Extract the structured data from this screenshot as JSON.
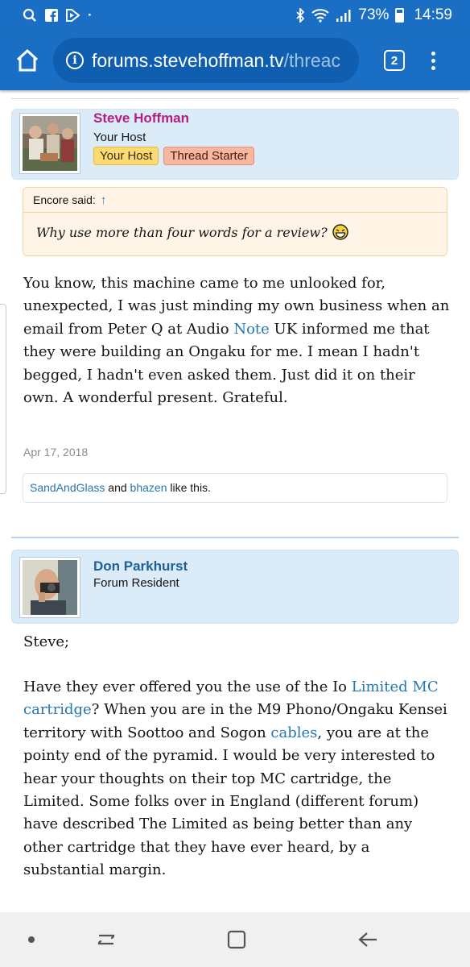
{
  "status_bar": {
    "battery": "73%",
    "time": "14:59"
  },
  "browser": {
    "url_domain": "forums.stevehoffman.tv",
    "url_path": "/threac",
    "tab_count": "2"
  },
  "post1": {
    "author": "Steve Hoffman",
    "author_title": "Your Host",
    "banners": [
      "Your Host",
      "Thread Starter"
    ],
    "quote_author": "Encore said:",
    "quote_arrow": "↑",
    "quote_text": "Why use more than four words for a review?",
    "text_before_link": "You know, this machine came to me unlooked for, unexpected, I was just minding my own business when an email from Peter Q at Audio ",
    "link_text": "Note",
    "text_after_link": " UK informed me that they were building an Ongaku for me. I mean I hadn't begged, I hadn't even asked them. Just did it on their own. A wonderful present. Grateful.",
    "date": "Apr 17, 2018",
    "liker1": "SandAndGlass",
    "likes_and": " and ",
    "liker2": "bhazen",
    "likes_suffix": " like this."
  },
  "post2": {
    "author": "Don Parkhurst",
    "author_title": "Forum Resident",
    "greeting": "Steve;",
    "p_part1": "Have they ever offered you the use of the Io ",
    "link1": "Limited MC cartridge",
    "p_part2": "? When you are in the M9 Phono/Ongaku Kensei territory with Soottoo and Sogon ",
    "link2": "cables",
    "p_part3": ", you are at the pointy end of the pyramid. I would be very interested to hear your thoughts on their top MC cartridge, the Limited. Some folks over in England (different forum) have described The Limited as being better than any other cartridge that they have ever heard, by a substantial margin."
  },
  "colors": {
    "browser_bar": "#1a6fc4",
    "author1_name": "#b0207f",
    "author2_name": "#1f5f96",
    "link": "#2577b1",
    "user_block_bg": "#dcebf8",
    "quote_bg": "#fff4e5"
  },
  "icons": [
    "search-icon",
    "facebook-icon",
    "flipboard-icon",
    "bluetooth-icon",
    "wifi-icon",
    "signal-icon",
    "battery-icon",
    "home-icon",
    "info-icon",
    "tabs-icon",
    "more-icon",
    "laughing-emoji-icon",
    "nav-dot-icon",
    "recents-icon",
    "home-nav-icon",
    "back-icon"
  ]
}
